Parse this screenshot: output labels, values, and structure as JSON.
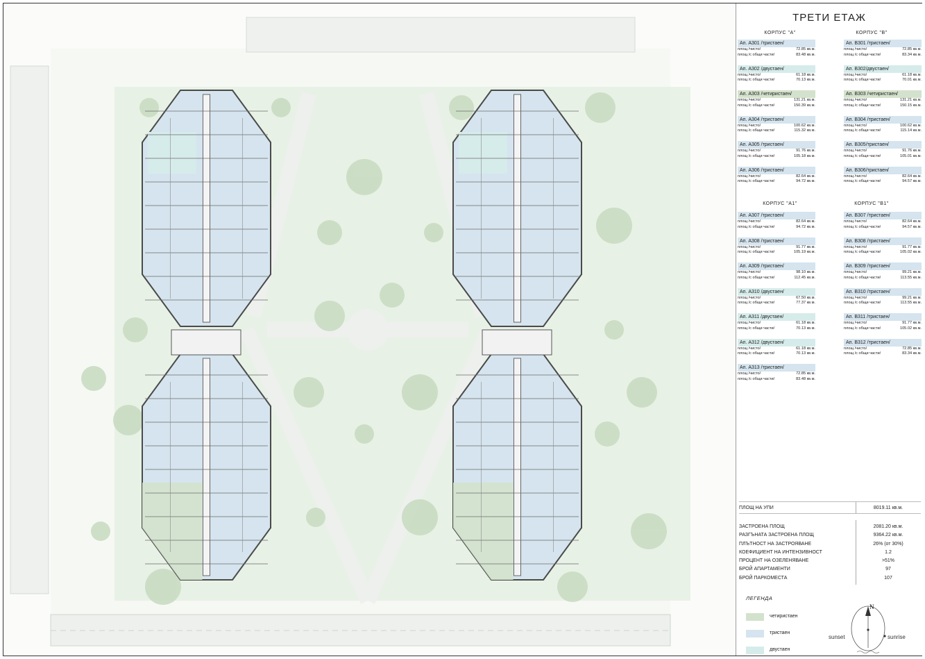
{
  "title": "ТРЕТИ ЕТАЖ",
  "colors": {
    "four_room": "#d3e2cc",
    "three_room": "#d5e4ee",
    "two_room": "#d6eceb",
    "greenery": "#cfe0c8",
    "building_outline": "#4a4a4a"
  },
  "block_labels": {
    "a": "КОРПУС \"А\"",
    "b": "КОРПУС \"В\"",
    "a1": "КОРПУС \"А1\"",
    "b1": "КОРПУС \"В1\""
  },
  "area_labels": {
    "net": "площ /чисто/",
    "gross": "площ /с общи части/"
  },
  "blocks": {
    "a": [
      {
        "name": "Ап. А301 /тристаен/",
        "type": "three",
        "net": "72.85 кв.м.",
        "gross": "83.48 кв.м."
      },
      {
        "name": "Ап. А302 /двустаен/",
        "type": "two",
        "net": "61.18 кв.м.",
        "gross": "70.13 кв.м."
      },
      {
        "name": "Ап. А303 /четиристаен/",
        "type": "four",
        "net": "131.21 кв.м.",
        "gross": "150.39 кв.м."
      },
      {
        "name": "Ап. А304 /тристаен/",
        "type": "three",
        "net": "100.62 кв.м.",
        "gross": "115.32 кв.м."
      },
      {
        "name": "Ап. А305 /тристаен/",
        "type": "three",
        "net": "91.76 кв.м.",
        "gross": "105.18 кв.м."
      },
      {
        "name": "Ап. А306 /тристаен/",
        "type": "three",
        "net": "82.64 кв.м.",
        "gross": "94.72 кв.м."
      }
    ],
    "b": [
      {
        "name": "Ап. В301 /тристаен/",
        "type": "three",
        "net": "72.85 кв.м.",
        "gross": "83.34 кв.м."
      },
      {
        "name": "Ап. В302/двустаен/",
        "type": "two",
        "net": "61.18 кв.м.",
        "gross": "70.01 кв.м."
      },
      {
        "name": "Ап. В303 /четиристаен/",
        "type": "four",
        "net": "131.21 кв.м.",
        "gross": "150.15 кв.м."
      },
      {
        "name": "Ап. В304 /тристаен/",
        "type": "three",
        "net": "100.62 кв.м.",
        "gross": "115.14 кв.м."
      },
      {
        "name": "Ап. В305/тристаен/",
        "type": "three",
        "net": "91.76 кв.м.",
        "gross": "105.01 кв.м."
      },
      {
        "name": "Ап. В306/тристаен/",
        "type": "three",
        "net": "82.64 кв.м.",
        "gross": "94.57 кв.м."
      }
    ],
    "a1": [
      {
        "name": "Ап. А307 /тристаен/",
        "type": "three",
        "net": "82.64 кв.м.",
        "gross": "94.72 кв.м."
      },
      {
        "name": "Ап. А308 /тристаен/",
        "type": "three",
        "net": "91.77 кв.м.",
        "gross": "105.19 кв.м."
      },
      {
        "name": "Ап. А309 /тристаен/",
        "type": "three",
        "net": "98.10 кв.м.",
        "gross": "112.45 кв.м."
      },
      {
        "name": "Ап. А310 /двустаен/",
        "type": "two",
        "net": "67.50 кв.м.",
        "gross": "77.37 кв.м."
      },
      {
        "name": "Ап. А311 /двустаен/",
        "type": "two",
        "net": "61.18 кв.м.",
        "gross": "70.13 кв.м."
      },
      {
        "name": "Ап. А312 /двустаен/",
        "type": "two",
        "net": "61.18 кв.м.",
        "gross": "70.13 кв.м."
      },
      {
        "name": "Ап. А313 /тристаен/",
        "type": "three",
        "net": "72.85 кв.м.",
        "gross": "83.48 кв.м."
      }
    ],
    "b1": [
      {
        "name": "Ап. В307 /тристаен/",
        "type": "three",
        "net": "82.64 кв.м.",
        "gross": "94.57 кв.м."
      },
      {
        "name": "Ап. В308 /тристаен/",
        "type": "three",
        "net": "91.77 кв.м.",
        "gross": "105.02 кв.м."
      },
      {
        "name": "Ап. В309 /тристаен/",
        "type": "three",
        "net": "99.21 кв.м.",
        "gross": "113.55 кв.м."
      },
      {
        "name": "Ап. В310 /тристаен/",
        "type": "three",
        "net": "99.21 кв.м.",
        "gross": "113.55 кв.м."
      },
      {
        "name": "Ап. В311 /тристаен/",
        "type": "three",
        "net": "91.77 кв.м.",
        "gross": "105.02 кв.м."
      },
      {
        "name": "Ап. В312 /тристаен/",
        "type": "three",
        "net": "72.85 кв.м.",
        "gross": "83.34 кв.м."
      }
    ]
  },
  "stats": [
    {
      "label": "ПЛОЩ НА УПИ",
      "value": "8019.11 кв.м."
    },
    {
      "label": "ЗАСТРОЕНА ПЛОЩ",
      "value": "2081.20 кв.м."
    },
    {
      "label": "РАЗГЪНАТА ЗАСТРОЕНА ПЛОЩ",
      "value": "9364.22 кв.м."
    },
    {
      "label": "ПЛЪТНОСТ НА ЗАСТРОЯВАНЕ",
      "value": "26% (от 30%)"
    },
    {
      "label": "КОЕФИЦИЕНТ НА ИНТЕНЗИВНОСТ",
      "value": "1.2"
    },
    {
      "label": "ПРОЦЕНТ НА ОЗЕЛЕНЯВАНЕ",
      "value": ">51%"
    },
    {
      "label": "БРОЙ АПАРТАМЕНТИ",
      "value": "97"
    },
    {
      "label": "БРОЙ ПАРКОМЕСТА",
      "value": "107"
    }
  ],
  "legend": {
    "title": "ЛЕГЕНДА",
    "items": [
      {
        "label": "четиристаен",
        "type": "four"
      },
      {
        "label": "тристаен",
        "type": "three"
      },
      {
        "label": "двустаен",
        "type": "two"
      }
    ]
  },
  "compass": {
    "north": "N",
    "sunset": "sunset",
    "sunrise": "sunrise"
  }
}
